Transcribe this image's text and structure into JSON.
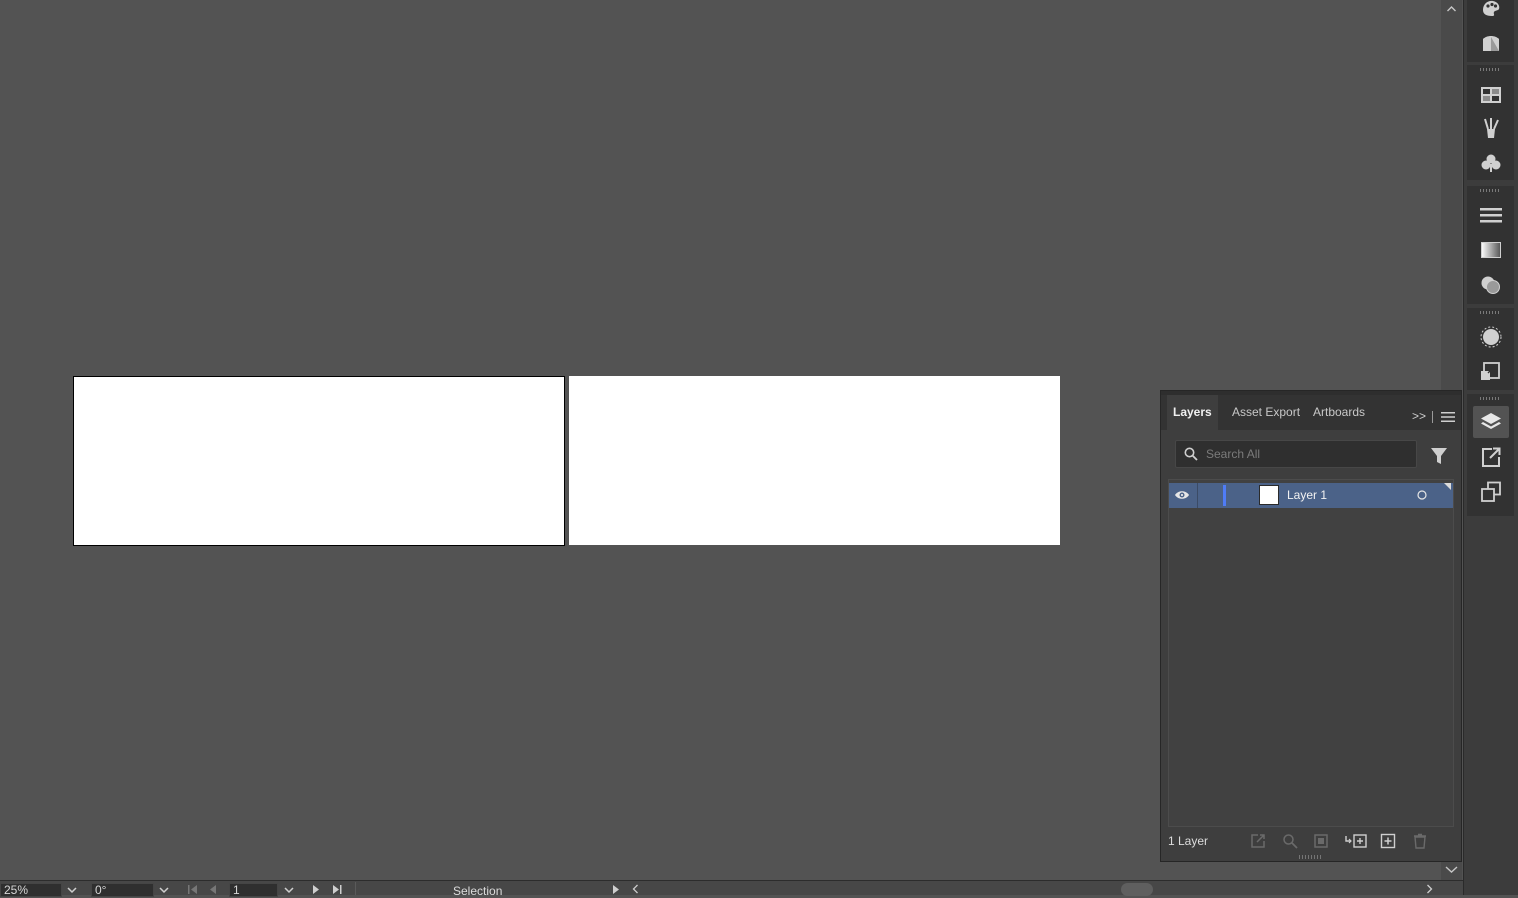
{
  "canvas": {
    "background": "#535353",
    "artboards": [
      "Artboard 1",
      "Artboard 2"
    ]
  },
  "panel": {
    "tabs": [
      {
        "label": "Layers",
        "active": true
      },
      {
        "label": "Asset Export",
        "active": false
      },
      {
        "label": "Artboards",
        "active": false
      }
    ],
    "more_label": ">>",
    "search_placeholder": "Search All",
    "layers": [
      {
        "name": "Layer 1",
        "visible": true,
        "color": "#4f7cf7",
        "selected": true
      }
    ],
    "status": "1 Layer",
    "footer_icons": [
      "export-icon",
      "locate-object-icon",
      "clipping-mask-icon",
      "new-sublayer-icon",
      "new-layer-icon",
      "trash-icon"
    ]
  },
  "dock_icons": [
    "color-guide-icon",
    "appearance-icon",
    "swatches-icon",
    "brushes-icon",
    "symbols-icon",
    "stroke-icon",
    "gradient-icon",
    "transparency-icon",
    "graphic-styles-icon",
    "asset-export-icon",
    "layers-icon",
    "export-icon",
    "artboards-icon"
  ],
  "bottombar": {
    "zoom": "25%",
    "rotation": "0°",
    "artboard_number": "1",
    "tool": "Selection"
  },
  "accent_color": "#4b6288"
}
